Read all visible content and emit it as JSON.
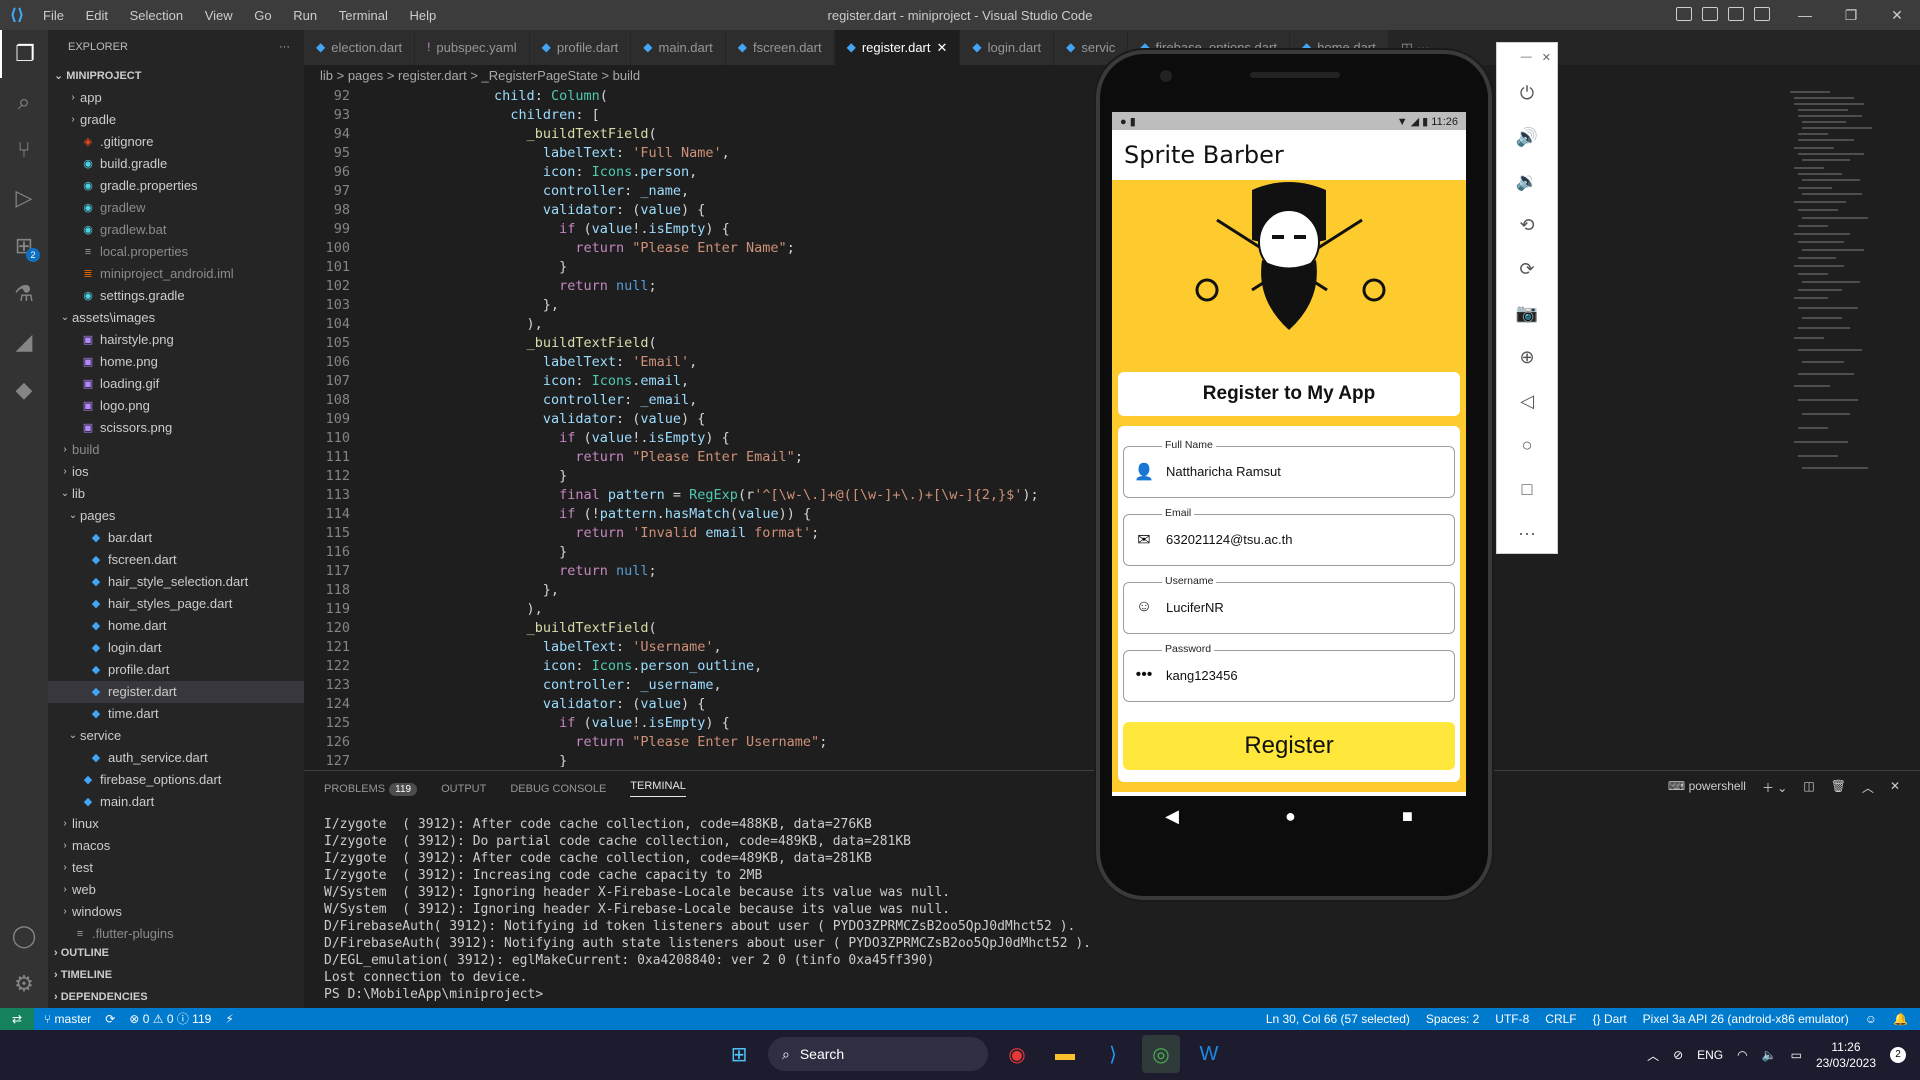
{
  "window": {
    "title": "register.dart - miniproject - Visual Studio Code"
  },
  "menu": [
    "File",
    "Edit",
    "Selection",
    "View",
    "Go",
    "Run",
    "Terminal",
    "Help"
  ],
  "explorer": {
    "header": "EXPLORER",
    "project": "MINIPROJECT",
    "items": [
      {
        "label": "app",
        "type": "folder",
        "indent": 1,
        "open": false
      },
      {
        "label": "gradle",
        "type": "folder",
        "indent": 1,
        "open": false
      },
      {
        "label": ".gitignore",
        "type": "file",
        "indent": 1
      },
      {
        "label": "build.gradle",
        "type": "file",
        "indent": 1
      },
      {
        "label": "gradle.properties",
        "type": "file",
        "indent": 1
      },
      {
        "label": "gradlew",
        "type": "file",
        "indent": 1,
        "dim": true
      },
      {
        "label": "gradlew.bat",
        "type": "file",
        "indent": 1,
        "dim": true
      },
      {
        "label": "local.properties",
        "type": "file",
        "indent": 1,
        "dim": true
      },
      {
        "label": "miniproject_android.iml",
        "type": "file",
        "indent": 1,
        "dim": true
      },
      {
        "label": "settings.gradle",
        "type": "file",
        "indent": 1
      },
      {
        "label": "assets\\images",
        "type": "folder",
        "indent": 0,
        "open": true
      },
      {
        "label": "hairstyle.png",
        "type": "file",
        "indent": 1
      },
      {
        "label": "home.png",
        "type": "file",
        "indent": 1
      },
      {
        "label": "loading.gif",
        "type": "file",
        "indent": 1
      },
      {
        "label": "logo.png",
        "type": "file",
        "indent": 1
      },
      {
        "label": "scissors.png",
        "type": "file",
        "indent": 1
      },
      {
        "label": "build",
        "type": "folder",
        "indent": 0,
        "open": false,
        "dim": true
      },
      {
        "label": "ios",
        "type": "folder",
        "indent": 0,
        "open": false
      },
      {
        "label": "lib",
        "type": "folder",
        "indent": 0,
        "open": true
      },
      {
        "label": "pages",
        "type": "folder",
        "indent": 1,
        "open": true
      },
      {
        "label": "bar.dart",
        "type": "file",
        "indent": 2
      },
      {
        "label": "fscreen.dart",
        "type": "file",
        "indent": 2
      },
      {
        "label": "hair_style_selection.dart",
        "type": "file",
        "indent": 2
      },
      {
        "label": "hair_styles_page.dart",
        "type": "file",
        "indent": 2
      },
      {
        "label": "home.dart",
        "type": "file",
        "indent": 2
      },
      {
        "label": "login.dart",
        "type": "file",
        "indent": 2
      },
      {
        "label": "profile.dart",
        "type": "file",
        "indent": 2
      },
      {
        "label": "register.dart",
        "type": "file",
        "indent": 2,
        "selected": true
      },
      {
        "label": "time.dart",
        "type": "file",
        "indent": 2
      },
      {
        "label": "service",
        "type": "folder",
        "indent": 1,
        "open": true
      },
      {
        "label": "auth_service.dart",
        "type": "file",
        "indent": 2
      },
      {
        "label": "firebase_options.dart",
        "type": "file",
        "indent": 1
      },
      {
        "label": "main.dart",
        "type": "file",
        "indent": 1
      },
      {
        "label": "linux",
        "type": "folder",
        "indent": 0,
        "open": false
      },
      {
        "label": "macos",
        "type": "folder",
        "indent": 0,
        "open": false
      },
      {
        "label": "test",
        "type": "folder",
        "indent": 0,
        "open": false
      },
      {
        "label": "web",
        "type": "folder",
        "indent": 0,
        "open": false
      },
      {
        "label": "windows",
        "type": "folder",
        "indent": 0,
        "open": false
      },
      {
        "label": ".flutter-plugins",
        "type": "file",
        "indent": 0,
        "dim": true
      }
    ],
    "sections": [
      "OUTLINE",
      "TIMELINE",
      "DEPENDENCIES"
    ]
  },
  "tabs": [
    {
      "label": "election.dart",
      "icon": "dart-icon",
      "active": false
    },
    {
      "label": "pubspec.yaml",
      "icon": "yaml-icon",
      "active": false
    },
    {
      "label": "profile.dart",
      "icon": "dart-icon",
      "active": false
    },
    {
      "label": "main.dart",
      "icon": "dart-icon",
      "active": false
    },
    {
      "label": "fscreen.dart",
      "icon": "dart-icon",
      "active": false
    },
    {
      "label": "register.dart",
      "icon": "dart-icon",
      "active": true
    },
    {
      "label": "login.dart",
      "icon": "dart-icon",
      "active": false
    },
    {
      "label": "servic",
      "icon": "dart-icon",
      "active": false
    },
    {
      "label": "firebase_options.dart",
      "icon": "dart-icon",
      "active": false
    },
    {
      "label": "home.dart",
      "icon": "dart-icon",
      "active": false
    }
  ],
  "breadcrumb": "lib > pages > register.dart > _RegisterPageState > build",
  "code": [
    {
      "n": "92",
      "t": "                child: Column("
    },
    {
      "n": "93",
      "t": "                  children: ["
    },
    {
      "n": "94",
      "t": "                    _buildTextField("
    },
    {
      "n": "95",
      "t": "                      labelText: 'Full Name',"
    },
    {
      "n": "96",
      "t": "                      icon: Icons.person,"
    },
    {
      "n": "97",
      "t": "                      controller: _name,"
    },
    {
      "n": "98",
      "t": "                      validator: (value) {"
    },
    {
      "n": "99",
      "t": "                        if (value!.isEmpty) {"
    },
    {
      "n": "100",
      "t": "                          return \"Please Enter Name\";"
    },
    {
      "n": "101",
      "t": "                        }"
    },
    {
      "n": "102",
      "t": "                        return null;"
    },
    {
      "n": "103",
      "t": "                      },"
    },
    {
      "n": "104",
      "t": "                    ),"
    },
    {
      "n": "105",
      "t": "                    _buildTextField("
    },
    {
      "n": "106",
      "t": "                      labelText: 'Email',"
    },
    {
      "n": "107",
      "t": "                      icon: Icons.email,"
    },
    {
      "n": "108",
      "t": "                      controller: _email,"
    },
    {
      "n": "109",
      "t": "                      validator: (value) {"
    },
    {
      "n": "110",
      "t": "                        if (value!.isEmpty) {"
    },
    {
      "n": "111",
      "t": "                          return \"Please Enter Email\";"
    },
    {
      "n": "112",
      "t": "                        }"
    },
    {
      "n": "113",
      "t": "                        final pattern = RegExp(r'^[\\w-\\.]+@([\\w-]+\\.)+[\\w-]{2,}$');"
    },
    {
      "n": "114",
      "t": "                        if (!pattern.hasMatch(value)) {"
    },
    {
      "n": "115",
      "t": "                          return 'Invalid email format';"
    },
    {
      "n": "116",
      "t": "                        }"
    },
    {
      "n": "117",
      "t": "                        return null;"
    },
    {
      "n": "118",
      "t": "                      },"
    },
    {
      "n": "119",
      "t": "                    ),"
    },
    {
      "n": "120",
      "t": "                    _buildTextField("
    },
    {
      "n": "121",
      "t": "                      labelText: 'Username',"
    },
    {
      "n": "122",
      "t": "                      icon: Icons.person_outline,"
    },
    {
      "n": "123",
      "t": "                      controller: _username,"
    },
    {
      "n": "124",
      "t": "                      validator: (value) {"
    },
    {
      "n": "125",
      "t": "                        if (value!.isEmpty) {"
    },
    {
      "n": "126",
      "t": "                          return \"Please Enter Username\";"
    },
    {
      "n": "127",
      "t": "                        }"
    }
  ],
  "panel": {
    "tabs": [
      "PROBLEMS",
      "OUTPUT",
      "DEBUG CONSOLE",
      "TERMINAL"
    ],
    "problems_count": "119",
    "shell": "powershell",
    "terminal": [
      "I/zygote  ( 3912): After code cache collection, code=488KB, data=276KB",
      "I/zygote  ( 3912): Do partial code cache collection, code=489KB, data=281KB",
      "I/zygote  ( 3912): After code cache collection, code=489KB, data=281KB",
      "I/zygote  ( 3912): Increasing code cache capacity to 2MB",
      "W/System  ( 3912): Ignoring header X-Firebase-Locale because its value was null.",
      "W/System  ( 3912): Ignoring header X-Firebase-Locale because its value was null.",
      "D/FirebaseAuth( 3912): Notifying id token listeners about user ( PYDO3ZPRMCZsB2oo5QpJ0dMhct52 ).",
      "D/FirebaseAuth( 3912): Notifying auth state listeners about user ( PYDO3ZPRMCZsB2oo5QpJ0dMhct52 ).",
      "D/EGL_emulation( 3912): eglMakeCurrent: 0xa4208840: ver 2 0 (tinfo 0xa45ff390)",
      "Lost connection to device.",
      "PS D:\\MobileApp\\miniproject> "
    ]
  },
  "statusbar": {
    "branch": "master",
    "errors": "0",
    "warnings": "0",
    "info": "119",
    "position": "Ln 30, Col 66 (57 selected)",
    "spaces": "Spaces: 2",
    "encoding": "UTF-8",
    "eol": "CRLF",
    "language": "Dart",
    "device": "Pixel 3a API 26 (android-x86 emulator)"
  },
  "taskbar": {
    "search_placeholder": "Search",
    "language": "ENG",
    "time": "11:26",
    "date": "23/03/2023",
    "notifications": "2"
  },
  "phone": {
    "status_time": "11:26",
    "app_title": "Sprite Barber",
    "register_title": "Register to My App",
    "fields": [
      {
        "label": "Full Name",
        "value": "Nattharicha Ramsut",
        "icon": "person-icon"
      },
      {
        "label": "Email",
        "value": "632021124@tsu.ac.th",
        "icon": "email-icon"
      },
      {
        "label": "Username",
        "value": "LuciferNR",
        "icon": "person-outline-icon"
      },
      {
        "label": "Password",
        "value": "kang123456",
        "icon": "password-icon"
      }
    ],
    "register_button": "Register"
  },
  "colors": {
    "accent": "#007acc",
    "app_yellow": "#fdcb2e",
    "button_yellow": "#ffe83b"
  }
}
